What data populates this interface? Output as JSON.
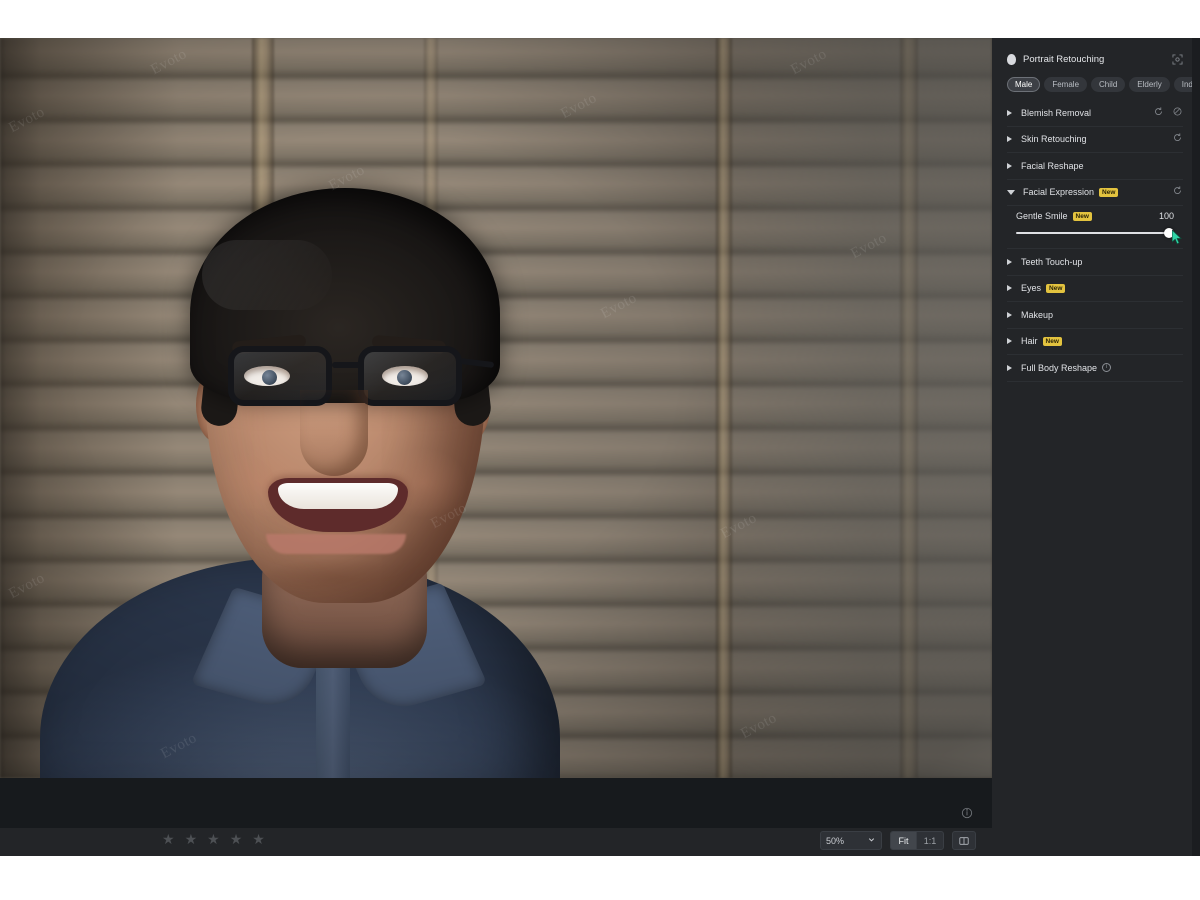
{
  "panel": {
    "title": "Portrait Retouching",
    "title_icon": "face-icon",
    "expand_icon": "expand-fullscreen-icon",
    "chips": [
      {
        "label": "Male",
        "active": true
      },
      {
        "label": "Female",
        "active": false
      },
      {
        "label": "Child",
        "active": false
      },
      {
        "label": "Elderly",
        "active": false
      },
      {
        "label": "Indiv.",
        "active": false
      }
    ],
    "sections": [
      {
        "label": "Blemish Removal",
        "expanded": false,
        "badge": "",
        "info": false,
        "icons": [
          "reset-icon",
          "brush-toggle-icon"
        ]
      },
      {
        "label": "Skin Retouching",
        "expanded": false,
        "badge": "",
        "info": false,
        "icons": [
          "reset-icon"
        ]
      },
      {
        "label": "Facial Reshape",
        "expanded": false,
        "badge": "",
        "info": false,
        "icons": []
      },
      {
        "label": "Facial Expression",
        "expanded": true,
        "badge": "New",
        "info": false,
        "icons": [
          "reset-icon"
        ]
      },
      {
        "label": "Teeth Touch-up",
        "expanded": false,
        "badge": "",
        "info": false,
        "icons": []
      },
      {
        "label": "Eyes",
        "expanded": false,
        "badge": "New",
        "info": false,
        "icons": []
      },
      {
        "label": "Makeup",
        "expanded": false,
        "badge": "",
        "info": false,
        "icons": []
      },
      {
        "label": "Hair",
        "expanded": false,
        "badge": "New",
        "info": false,
        "icons": []
      },
      {
        "label": "Full Body Reshape",
        "expanded": false,
        "badge": "",
        "info": true,
        "icons": []
      }
    ],
    "slider": {
      "name": "Gentle Smile",
      "badge": "New",
      "value": "100",
      "percent": 100
    }
  },
  "viewer": {
    "info_icon": "info-icon",
    "watermark_text": "Evoto",
    "rating": {
      "icon": "star-icon",
      "total": 5,
      "filled": 0
    },
    "zoom_level": "50%",
    "zoom_caret_icon": "chevron-down-icon",
    "fit_label": "Fit",
    "one_to_one_label": "1:1",
    "compare_icon": "split-compare-icon"
  },
  "colors": {
    "panel_bg": "#232528",
    "canvas_bg": "#171a1d",
    "badge": "#e3c33f",
    "cursor": "#2fd3a5",
    "accent_text": "#e0e2e6"
  }
}
